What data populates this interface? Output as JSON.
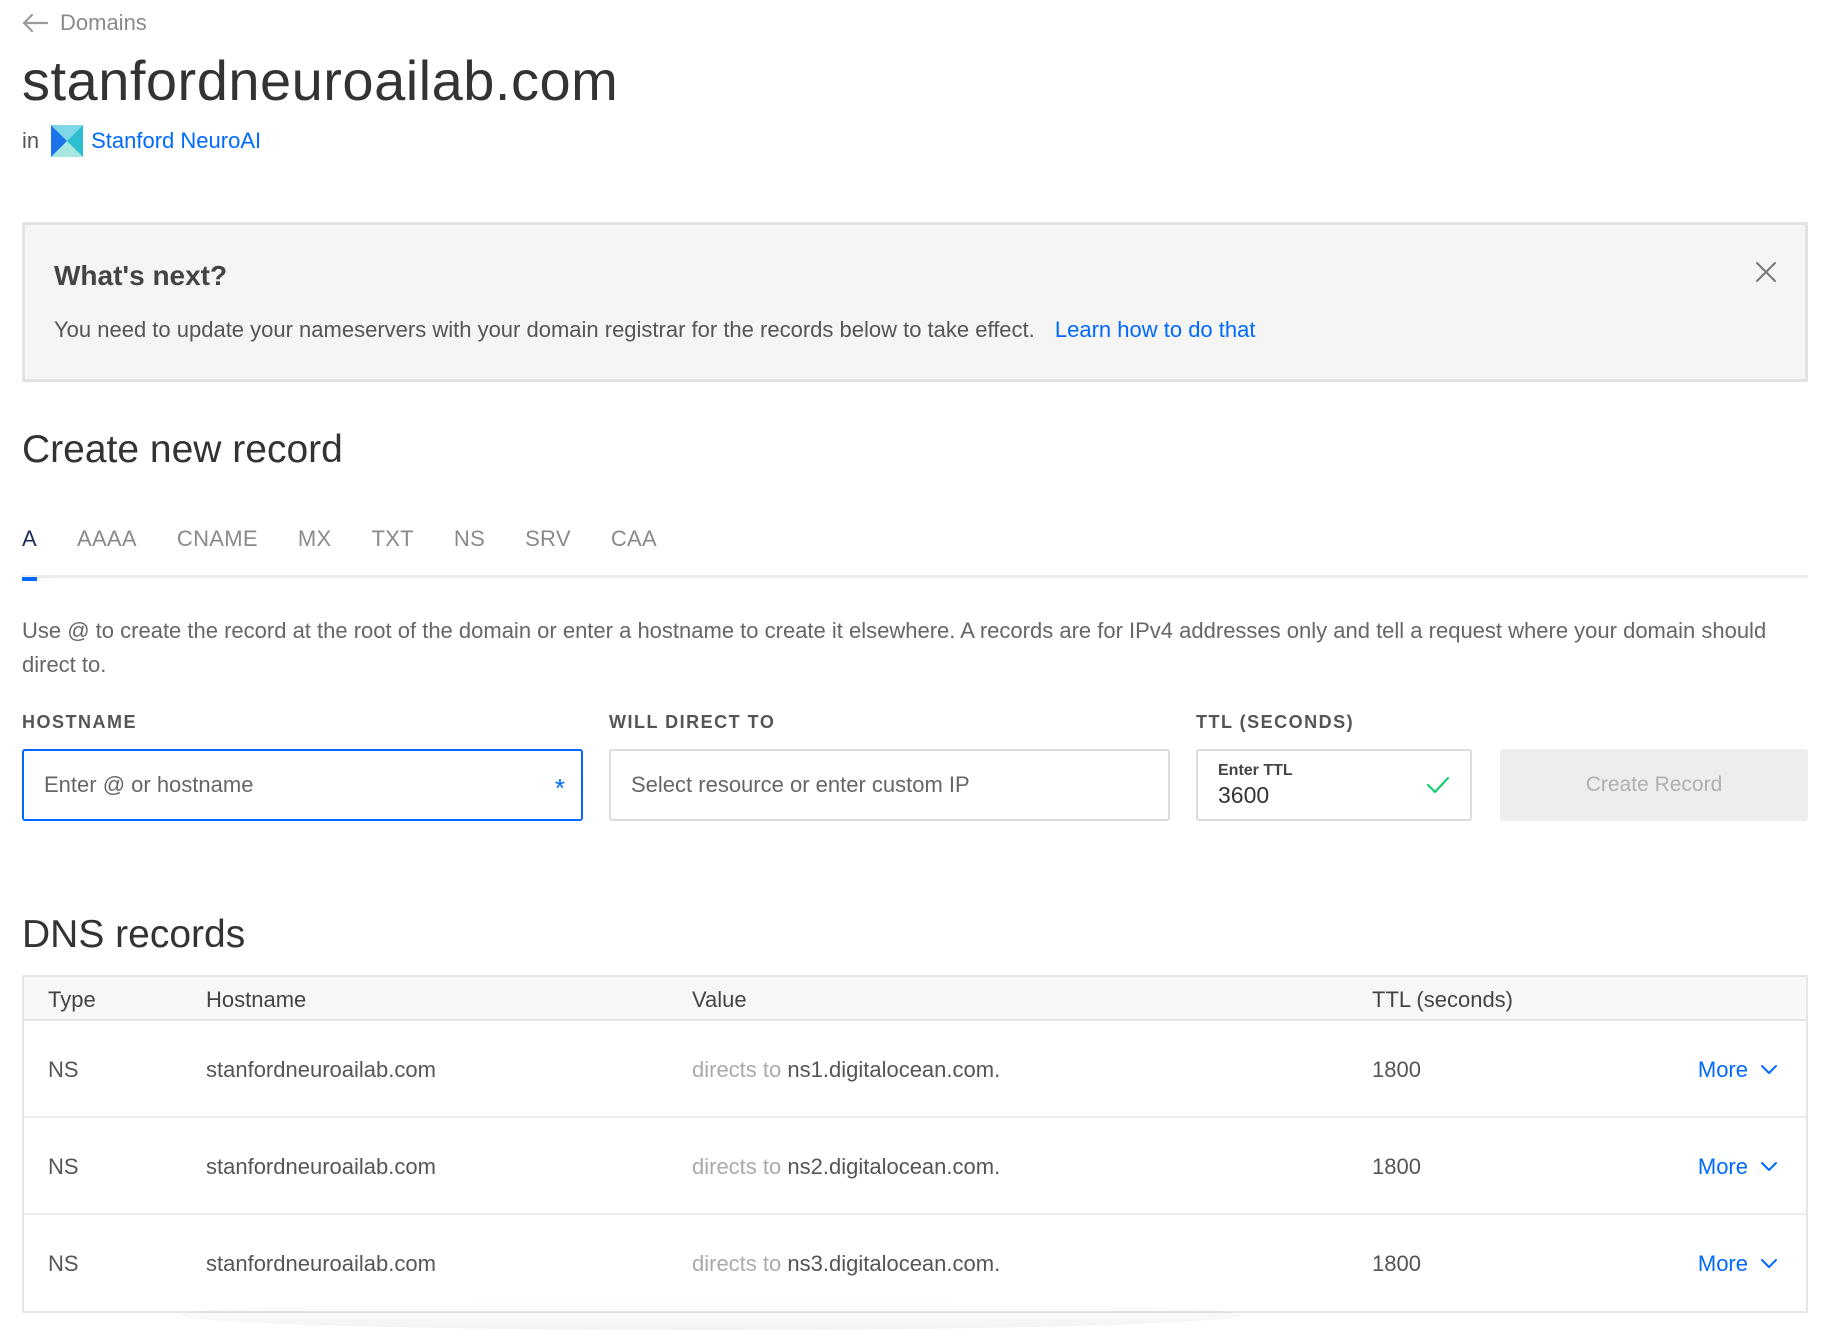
{
  "breadcrumb": {
    "label": "Domains"
  },
  "domain": {
    "name": "stanfordneuroailab.com",
    "in_label": "in",
    "team_name": "Stanford NeuroAI"
  },
  "alert": {
    "title": "What's next?",
    "text": "You need to update your nameservers with your domain registrar for the records below to take effect.",
    "link": "Learn how to do that"
  },
  "create": {
    "title": "Create new record",
    "tabs": [
      "A",
      "AAAA",
      "CNAME",
      "MX",
      "TXT",
      "NS",
      "SRV",
      "CAA"
    ],
    "active_tab": "A",
    "help": "Use @ to create the record at the root of the domain or enter a hostname to create it elsewhere. A records are for IPv4 addresses only and tell a request where your domain should direct to.",
    "hostname_label": "HOSTNAME",
    "hostname_placeholder": "Enter @ or hostname",
    "required_mark": "*",
    "direct_label": "WILL DIRECT TO",
    "direct_placeholder": "Select resource or enter custom IP",
    "ttl_label": "TTL (SECONDS)",
    "ttl_small": "Enter TTL",
    "ttl_value": "3600",
    "button": "Create Record"
  },
  "dns": {
    "title": "DNS records",
    "headers": {
      "type": "Type",
      "hostname": "Hostname",
      "value": "Value",
      "ttl": "TTL (seconds)"
    },
    "rows": [
      {
        "type": "NS",
        "hostname": "stanfordneuroailab.com",
        "prefix": "directs to",
        "value": "ns1.digitalocean.com.",
        "ttl": "1800",
        "more": "More"
      },
      {
        "type": "NS",
        "hostname": "stanfordneuroailab.com",
        "prefix": "directs to",
        "value": "ns2.digitalocean.com.",
        "ttl": "1800",
        "more": "More"
      },
      {
        "type": "NS",
        "hostname": "stanfordneuroailab.com",
        "prefix": "directs to",
        "value": "ns3.digitalocean.com.",
        "ttl": "1800",
        "more": "More"
      }
    ]
  },
  "colors": {
    "accent": "#0069ff",
    "active_tab_text": "#1c2a5c",
    "success": "#15cd72"
  }
}
